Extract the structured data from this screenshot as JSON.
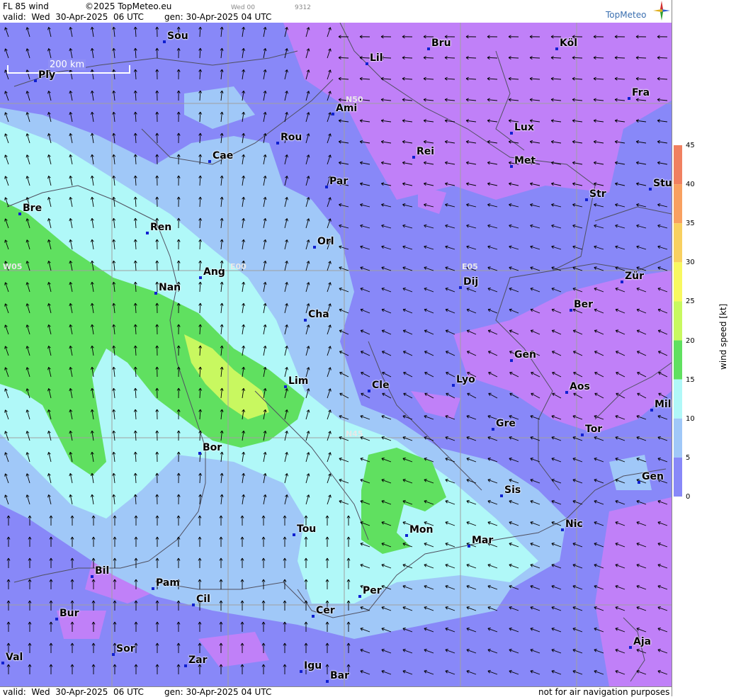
{
  "header": {
    "title": "FL 85 wind",
    "copyright": "©2025 TopMeteo.eu",
    "small1": "Wed 00",
    "small2": "9312",
    "valid": "valid:  Wed  30-Apr-2025  06 UTC",
    "gen": "gen: 30-Apr-2025 04 UTC",
    "logo": "TopMeteo"
  },
  "footer": {
    "valid": "valid:  Wed  30-Apr-2025  06 UTC",
    "gen": "gen: 30-Apr-2025 04 UTC",
    "note": "not for air navigation purposes"
  },
  "scale_label": "200 km",
  "grid_labels": [
    "N50",
    "W05",
    "E00",
    "E05",
    "N45"
  ],
  "legend": {
    "title": "wind  speed  [kt]",
    "ticks": [
      "45",
      "40",
      "35",
      "30",
      "25",
      "20",
      "15",
      "10",
      "5",
      "0"
    ],
    "colors": [
      "#f08060",
      "#f8a060",
      "#f8d060",
      "#f8f860",
      "#c8f860",
      "#60e060",
      "#b0f8f8",
      "#a0c8f8",
      "#8888f8",
      "#c080f8"
    ]
  },
  "cities": [
    {
      "name": "Sou"
    },
    {
      "name": "Bru"
    },
    {
      "name": "Köl"
    },
    {
      "name": "Lil"
    },
    {
      "name": "Ply"
    },
    {
      "name": "Ami"
    },
    {
      "name": "Fra"
    },
    {
      "name": "Lux"
    },
    {
      "name": "Rou"
    },
    {
      "name": "Cae"
    },
    {
      "name": "Rei"
    },
    {
      "name": "Met"
    },
    {
      "name": "Par"
    },
    {
      "name": "Stu"
    },
    {
      "name": "Str"
    },
    {
      "name": "Bre"
    },
    {
      "name": "Ren"
    },
    {
      "name": "Orl"
    },
    {
      "name": "Ang"
    },
    {
      "name": "Dij"
    },
    {
      "name": "Zür"
    },
    {
      "name": "Nan"
    },
    {
      "name": "Cha"
    },
    {
      "name": "Ber"
    },
    {
      "name": "Gen"
    },
    {
      "name": "Lim"
    },
    {
      "name": "Cle"
    },
    {
      "name": "Lyo"
    },
    {
      "name": "Aos"
    },
    {
      "name": "Mil"
    },
    {
      "name": "Gre"
    },
    {
      "name": "Tor"
    },
    {
      "name": "Bor"
    },
    {
      "name": "Gen"
    },
    {
      "name": "Sis"
    },
    {
      "name": "Nic"
    },
    {
      "name": "Tou"
    },
    {
      "name": "Mon"
    },
    {
      "name": "Mar"
    },
    {
      "name": "Bil"
    },
    {
      "name": "Pam"
    },
    {
      "name": "Cil"
    },
    {
      "name": "Per"
    },
    {
      "name": "Bur"
    },
    {
      "name": "Cer"
    },
    {
      "name": "Aja"
    },
    {
      "name": "Sor"
    },
    {
      "name": "Val"
    },
    {
      "name": "Zar"
    },
    {
      "name": "Igu"
    },
    {
      "name": "Bar"
    }
  ]
}
